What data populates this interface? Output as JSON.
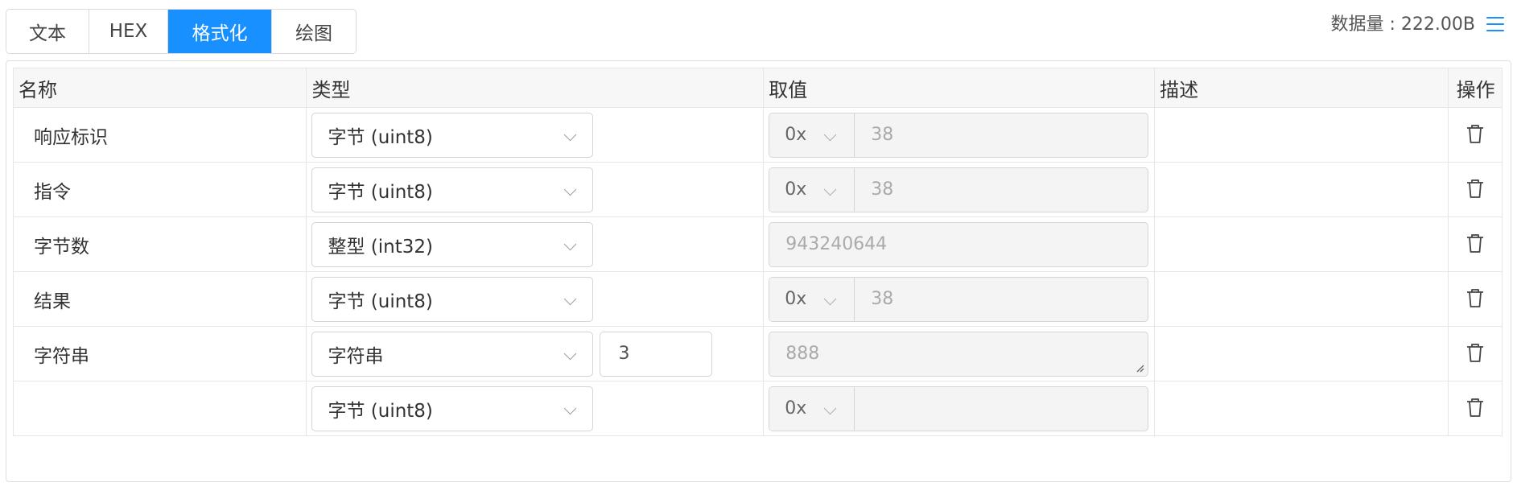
{
  "tabs": [
    {
      "label": "文本"
    },
    {
      "label": "HEX"
    },
    {
      "label": "格式化",
      "active": true
    },
    {
      "label": "绘图"
    }
  ],
  "datasize": "数据量 : 222.00B",
  "icons": {
    "menu": "hamburger-menu-icon",
    "delete": "trash-icon",
    "dropdown": "chevron-down-icon"
  },
  "colors": {
    "accent": "#1890ff"
  },
  "table": {
    "headers": {
      "name": "名称",
      "type": "类型",
      "value": "取值",
      "desc": "描述",
      "op": "操作"
    },
    "rows": [
      {
        "name": "响应标识",
        "type": "字节 (uint8)",
        "prefix": "0x",
        "value": "38",
        "desc": ""
      },
      {
        "name": "指令",
        "type": "字节 (uint8)",
        "prefix": "0x",
        "value": "38",
        "desc": ""
      },
      {
        "name": "字节数",
        "type": "整型 (int32)",
        "value": "943240644",
        "desc": ""
      },
      {
        "name": "结果",
        "type": "字节 (uint8)",
        "prefix": "0x",
        "value": "38",
        "desc": ""
      },
      {
        "name": "字符串",
        "type": "字符串",
        "length": "3",
        "value": "888",
        "desc": ""
      },
      {
        "name": "",
        "type": "字节 (uint8)",
        "prefix": "0x",
        "value": "",
        "desc": ""
      }
    ]
  }
}
